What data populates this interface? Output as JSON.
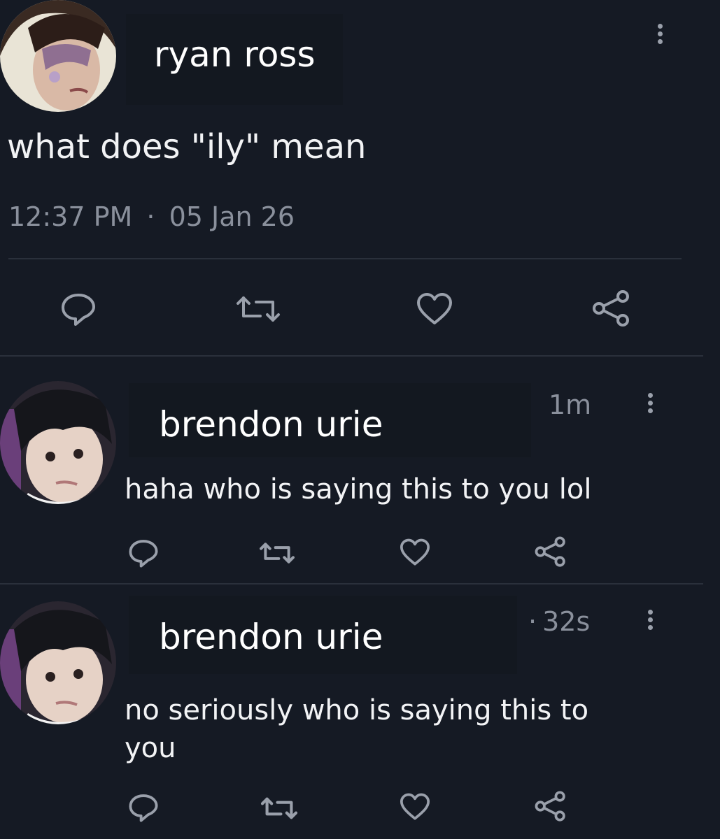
{
  "tweet": {
    "author": "ryan ross",
    "text": "what does \"ily\" mean",
    "time": "12:37 PM",
    "separator": "·",
    "date": "05 Jan 26"
  },
  "replies": [
    {
      "author": "brendon urie",
      "time": "1m",
      "text": "haha who is saying this to you lol"
    },
    {
      "author": "brendon urie",
      "time_prefix": "·",
      "time": "32s",
      "text_line1": "no seriously who is saying this to",
      "text_line2": "you"
    }
  ],
  "icons": {
    "reply": "speech-bubble-icon",
    "retweet": "retweet-icon",
    "like": "heart-icon",
    "share": "share-icon",
    "more": "more-vertical-icon"
  },
  "colors": {
    "background": "#151a24",
    "text": "#ffffff",
    "muted": "#8a909c",
    "icon": "#9aa0ab",
    "divider": "#2a303b"
  }
}
